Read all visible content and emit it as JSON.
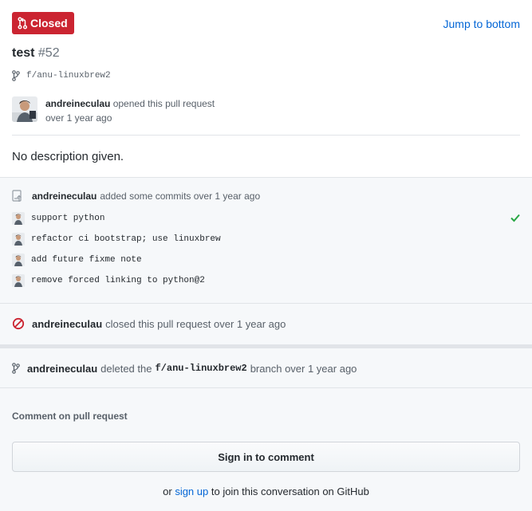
{
  "header": {
    "state_label": "Closed",
    "jump_label": "Jump to bottom",
    "title": "test",
    "number": "#52",
    "branch": "f/anu-linuxbrew2",
    "author": "andreineculau",
    "opened_text": "opened this pull request",
    "opened_time": "over 1 year ago",
    "description": "No description given."
  },
  "commits": {
    "author": "andreineculau",
    "summary": "added some commits over 1 year ago",
    "items": [
      {
        "message": "support python",
        "status": "check-icon"
      },
      {
        "message": "refactor ci bootstrap; use linuxbrew"
      },
      {
        "message": "add future fixme note"
      },
      {
        "message": "remove forced linking to python@2"
      }
    ]
  },
  "closed_event": {
    "author": "andreineculau",
    "text": "closed this pull request over 1 year ago"
  },
  "deleted_event": {
    "author": "andreineculau",
    "prefix": "deleted the",
    "branch": "f/anu-linuxbrew2",
    "suffix": "branch over 1 year ago"
  },
  "comment": {
    "label": "Comment on pull request",
    "signin_label": "Sign in to comment",
    "or_text": "or",
    "signup_link": "sign up",
    "join_text": "to join this conversation on GitHub"
  },
  "colors": {
    "closed_red": "#cb2431",
    "link_blue": "#0366d6",
    "success_green": "#28a745"
  }
}
